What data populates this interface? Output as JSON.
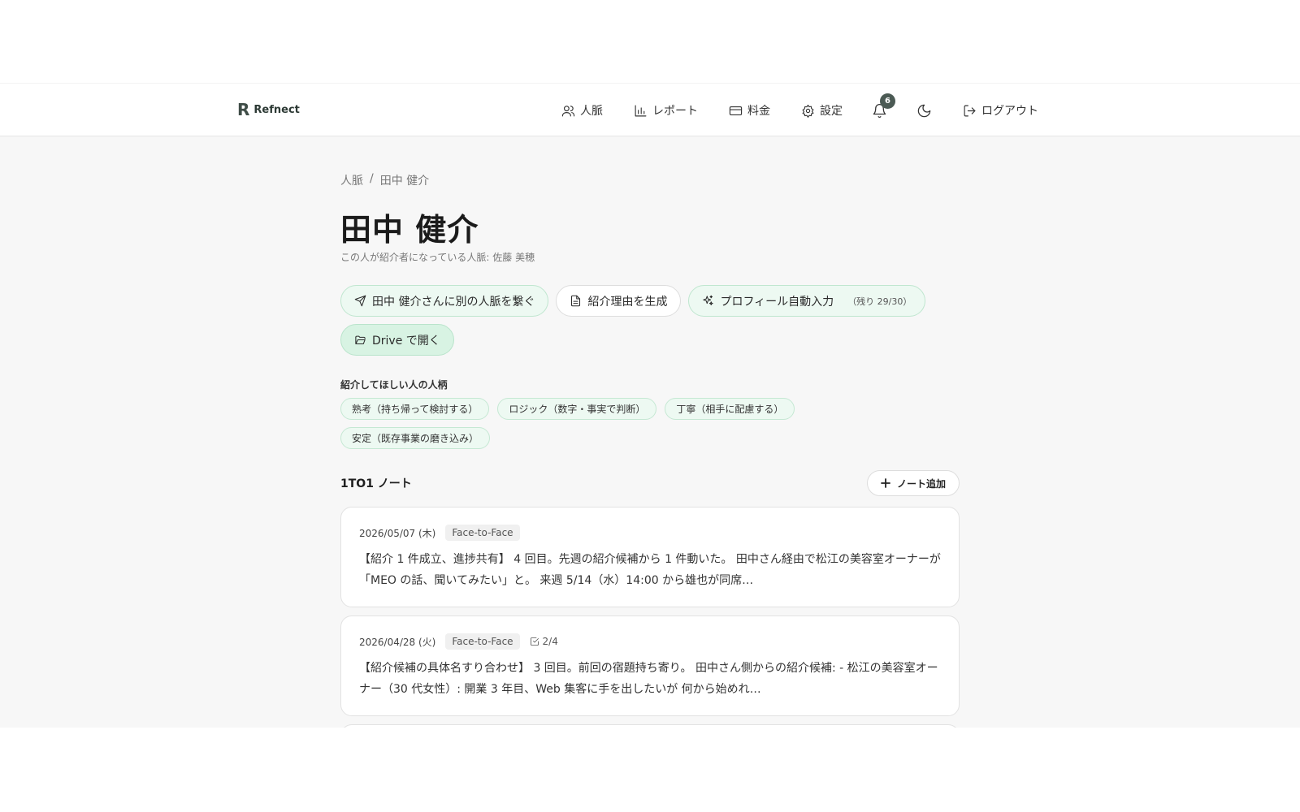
{
  "app": {
    "logo_mark": "R",
    "logo_text": "Refnect"
  },
  "nav": {
    "contacts": "人脈",
    "reports": "レポート",
    "pricing": "料金",
    "settings": "設定",
    "notifications_count": "6",
    "logout": "ログアウト"
  },
  "breadcrumb": {
    "root": "人脈",
    "sep": "/",
    "current": "田中 健介"
  },
  "page": {
    "title": "田中 健介",
    "subtitle": "この人が紹介者になっている人脈: 佐藤 美穂"
  },
  "actions": {
    "connect": "田中 健介さんに別の人脈を繋ぐ",
    "reason": "紹介理由を生成",
    "autofill": "プロフィール自動入力",
    "autofill_remaining": "（残り 29/30）",
    "drive": "Drive で開く"
  },
  "traits": {
    "label": "紹介してほしい人の人柄",
    "items": [
      "熟考（持ち帰って検討する）",
      "ロジック（数字・事実で判断）",
      "丁寧（相手に配慮する）",
      "安定（既存事業の磨き込み）"
    ]
  },
  "notes": {
    "title": "1TO1 ノート",
    "add_label": "ノート追加",
    "items": [
      {
        "date": "2026/05/07 (木)",
        "type": "Face-to-Face",
        "tasks": "",
        "body": "【紹介 1 件成立、進捗共有】 4 回目。先週の紹介候補から 1 件動いた。 田中さん経由で松江の美容室オーナーが「MEO の話、聞いてみたい」と。 来週 5/14（水）14:00 から雄也が同席…"
      },
      {
        "date": "2026/04/28 (火)",
        "type": "Face-to-Face",
        "tasks": "2/4",
        "body": "【紹介候補の具体名すり合わせ】 3 回目。前回の宿題持ち寄り。 田中さん側からの紹介候補: - 松江の美容室オーナー（30 代女性）: 開業 3 年目、Web 集客に手を出したいが 何から始めれ…"
      }
    ]
  }
}
